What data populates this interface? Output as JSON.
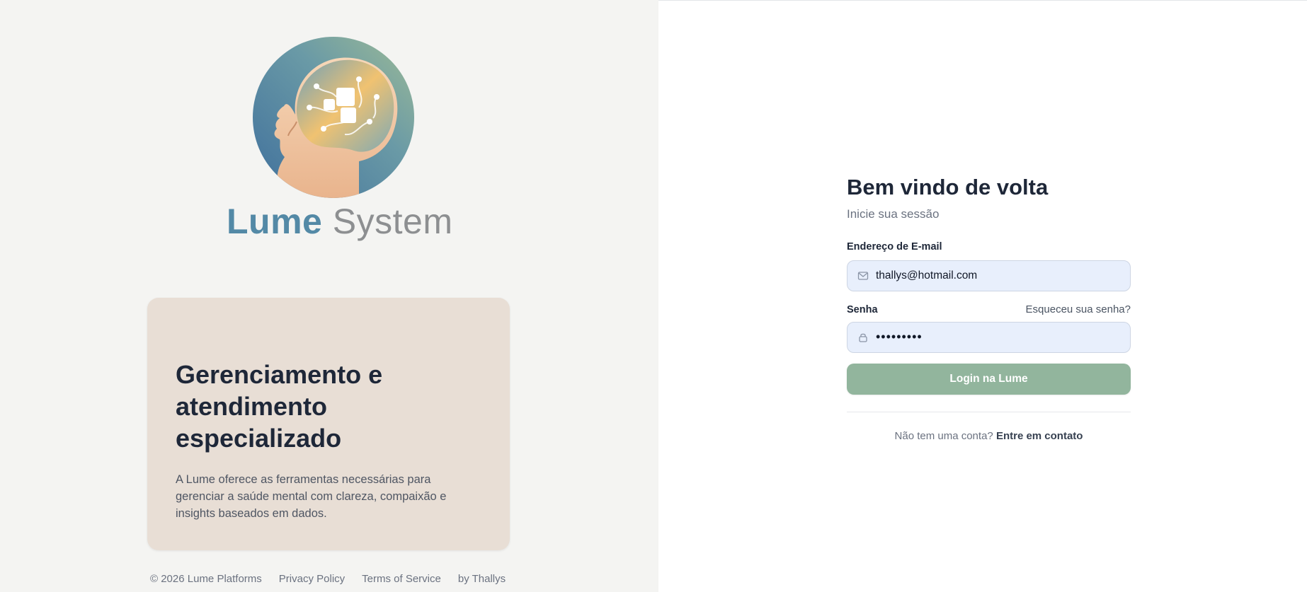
{
  "brand": {
    "name_part1": "Lume",
    "name_part2": "System"
  },
  "promo": {
    "title": "Gerenciamento e atendimento especializado",
    "description": "A Lume oferece as ferramentas necessárias para gerenciar a saúde mental com clareza, compaixão e insights baseados em dados."
  },
  "footer": {
    "copyright": "© 2026 Lume Platforms",
    "privacy": "Privacy Policy",
    "terms": "Terms of Service",
    "author": "by Thallys"
  },
  "login": {
    "title": "Bem vindo de volta",
    "subtitle": "Inicie sua sessão",
    "email_label": "Endereço de E-mail",
    "email_value": "thallys@hotmail.com",
    "password_label": "Senha",
    "forgot_link": "Esqueceu sua senha?",
    "password_value": "•••••••••",
    "submit_label": "Login na Lume",
    "no_account_text": "Não tem uma conta?",
    "contact_link": "Entre em contato"
  },
  "icons": {
    "email": "mail-icon",
    "password": "lock-icon",
    "logo": "brain-head-logo-icon"
  },
  "colors": {
    "left_bg": "#f4f4f2",
    "card_bg": "#e8ded5",
    "button_bg": "#92b59d",
    "input_bg": "#e8effc",
    "brand_blue": "#5389a6",
    "brand_gray": "#8d8f91"
  }
}
